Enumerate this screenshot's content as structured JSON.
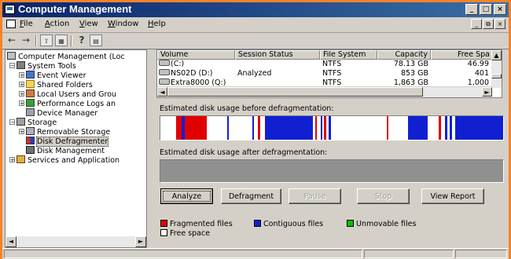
{
  "window": {
    "title": "Computer Management",
    "controls": {
      "minimize": "_",
      "maximize": "□",
      "close": "×"
    }
  },
  "menu": {
    "items": [
      {
        "pre": "",
        "u": "F",
        "post": "ile"
      },
      {
        "pre": "",
        "u": "A",
        "post": "ction"
      },
      {
        "pre": "",
        "u": "V",
        "post": "iew"
      },
      {
        "pre": "",
        "u": "W",
        "post": "indow"
      },
      {
        "pre": "",
        "u": "H",
        "post": "elp"
      }
    ],
    "mdi_controls": {
      "minimize": "_",
      "restore": "⧉",
      "close": "×"
    }
  },
  "toolbar": {
    "back_icon": "←",
    "forward_icon": "→",
    "up_icon": "⇧",
    "show_tree_icon": "▦",
    "help_icon": "?",
    "console_icon": "▤"
  },
  "tree": {
    "root": "Computer Management (Loc",
    "system_tools": "System Tools",
    "event_viewer": "Event Viewer",
    "shared_folders": "Shared Folders",
    "local_users": "Local Users and Grou",
    "perf_logs": "Performance Logs an",
    "device_manager": "Device Manager",
    "storage": "Storage",
    "removable_storage": "Removable Storage",
    "disk_defragmenter": "Disk Defragmenter",
    "disk_management": "Disk Management",
    "services": "Services and Application",
    "expand_minus": "−",
    "expand_plus": "+"
  },
  "volumes": {
    "headers": {
      "volume": "Volume",
      "session_status": "Session Status",
      "file_system": "File System",
      "capacity": "Capacity",
      "free_space": "Free Spa"
    },
    "rows": [
      {
        "volume": "(C:)",
        "status": "",
        "fs": "NTFS",
        "capacity": "78.13 GB",
        "free": "46.99"
      },
      {
        "volume": "NS02D (D:)",
        "status": "Analyzed",
        "fs": "NTFS",
        "capacity": "853 GB",
        "free": "401"
      },
      {
        "volume": "Extra8000 (Q:)",
        "status": "",
        "fs": "NTFS",
        "capacity": "1,863 GB",
        "free": "1,000"
      }
    ]
  },
  "analysis": {
    "before_label": "Estimated disk usage before defragmentation:",
    "after_label": "Estimated disk usage after defragmentation:"
  },
  "colors": {
    "fragmented": "#e00000",
    "contiguous": "#1020d0",
    "unmovable": "#00c000",
    "free": "#ffffff",
    "after_bg": "#909090"
  },
  "disk_map_before": [
    {
      "start": 0.045,
      "end": 0.135,
      "type": "fragmented"
    },
    {
      "start": 0.062,
      "end": 0.072,
      "type": "contiguous"
    },
    {
      "start": 0.195,
      "end": 0.2,
      "type": "contiguous"
    },
    {
      "start": 0.268,
      "end": 0.272,
      "type": "contiguous"
    },
    {
      "start": 0.285,
      "end": 0.292,
      "type": "fragmented"
    },
    {
      "start": 0.305,
      "end": 0.31,
      "type": "contiguous"
    },
    {
      "start": 0.308,
      "end": 0.445,
      "type": "contiguous"
    },
    {
      "start": 0.451,
      "end": 0.457,
      "type": "fragmented"
    },
    {
      "start": 0.468,
      "end": 0.472,
      "type": "contiguous"
    },
    {
      "start": 0.478,
      "end": 0.484,
      "type": "fragmented"
    },
    {
      "start": 0.49,
      "end": 0.497,
      "type": "contiguous"
    },
    {
      "start": 0.66,
      "end": 0.665,
      "type": "fragmented"
    },
    {
      "start": 0.722,
      "end": 0.78,
      "type": "contiguous"
    },
    {
      "start": 0.812,
      "end": 0.818,
      "type": "fragmented"
    },
    {
      "start": 0.83,
      "end": 0.838,
      "type": "contiguous"
    },
    {
      "start": 0.845,
      "end": 0.85,
      "type": "contiguous"
    },
    {
      "start": 0.86,
      "end": 1.0,
      "type": "contiguous"
    }
  ],
  "buttons": {
    "analyze": "Analyze",
    "defragment": "Defragment",
    "pause": "Pause",
    "stop": "Stop",
    "view_report": "View Report"
  },
  "legend": {
    "fragmented": "Fragmented files",
    "contiguous": "Contiguous files",
    "unmovable": "Unmovable files",
    "free": "Free space"
  }
}
